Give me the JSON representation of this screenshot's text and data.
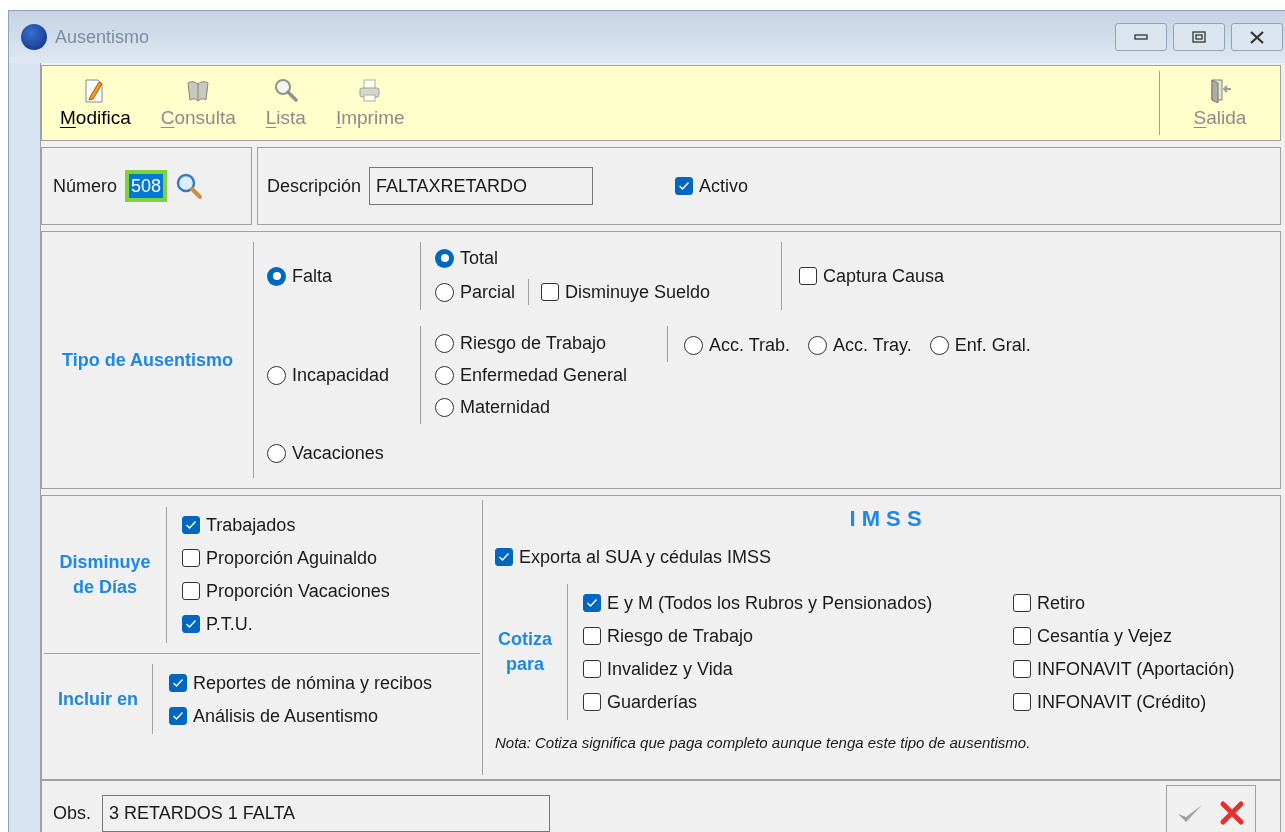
{
  "window": {
    "title": "Ausentismo"
  },
  "toolbar": {
    "items": [
      {
        "kind": "edit",
        "label": "Modifica",
        "disabled": false
      },
      {
        "kind": "book",
        "label": "Consulta",
        "disabled": true
      },
      {
        "kind": "search",
        "label": "Lista",
        "disabled": true
      },
      {
        "kind": "printer",
        "label": "Imprime",
        "disabled": true
      }
    ],
    "exit": {
      "kind": "exit",
      "label": "Salida",
      "disabled": true
    }
  },
  "numero": {
    "label": "Número",
    "value": "508",
    "focused": true
  },
  "descripcion": {
    "label": "Descripción",
    "value": "FALTAXRETARDO"
  },
  "activo": {
    "label": "Activo",
    "checked": true
  },
  "tipo": {
    "title": "Tipo de Ausentismo",
    "options": [
      {
        "kind": "falta",
        "label": "Falta",
        "selected": true,
        "modes": [
          {
            "label": "Total",
            "selected": true
          },
          {
            "label": "Parcial",
            "selected": false
          }
        ],
        "reduces_salary": {
          "label": "Disminuye Sueldo",
          "checked": false
        },
        "capture_cause": {
          "label": "Captura Causa",
          "checked": false
        }
      },
      {
        "kind": "incapacidad",
        "label": "Incapacidad",
        "selected": false,
        "types": [
          {
            "label": "Riesgo de Trabajo",
            "selected": false
          },
          {
            "label": "Enfermedad General",
            "selected": false
          },
          {
            "label": "Maternidad",
            "selected": false
          }
        ],
        "subtypes": [
          {
            "label": "Acc. Trab.",
            "selected": false
          },
          {
            "label": "Acc. Tray.",
            "selected": false
          },
          {
            "label": "Enf. Gral.",
            "selected": false
          }
        ]
      },
      {
        "kind": "simple",
        "label": "Vacaciones",
        "selected": false
      }
    ]
  },
  "disminuye": {
    "title": "Disminuye de Días",
    "items": [
      {
        "label": "Trabajados",
        "checked": true
      },
      {
        "label": "Proporción Aguinaldo",
        "checked": false
      },
      {
        "label": "Proporción Vacaciones",
        "checked": false
      },
      {
        "label": "P.T.U.",
        "checked": true
      }
    ]
  },
  "incluir": {
    "title": "Incluir en",
    "items": [
      {
        "label": "Reportes de nómina y recibos",
        "checked": true
      },
      {
        "label": "Análisis de Ausentismo",
        "checked": true
      }
    ]
  },
  "imss": {
    "title": "I M S S",
    "export": {
      "label": "Exporta al SUA y cédulas IMSS",
      "checked": true
    },
    "cotiza": {
      "title": "Cotiza para",
      "columns": [
        [
          {
            "label": "E y M (Todos los Rubros y Pensionados)",
            "checked": true
          },
          {
            "label": "Riesgo de Trabajo",
            "checked": false
          },
          {
            "label": "Invalidez y Vida",
            "checked": false
          },
          {
            "label": "Guarderías",
            "checked": false
          }
        ],
        [
          {
            "label": "Retiro",
            "checked": false
          },
          {
            "label": "Cesantía y Vejez",
            "checked": false
          },
          {
            "label": "INFONAVIT (Aportación)",
            "checked": false
          },
          {
            "label": "INFONAVIT (Crédito)",
            "checked": false
          }
        ]
      ]
    },
    "note": "Nota: Cotiza significa que paga completo aunque tenga este tipo de ausentismo."
  },
  "obs": {
    "label": "Obs.",
    "value": "3 RETARDOS 1 FALTA"
  },
  "actions": [
    {
      "kind": "accept",
      "disabled": true
    },
    {
      "kind": "cancel",
      "disabled": false
    }
  ]
}
